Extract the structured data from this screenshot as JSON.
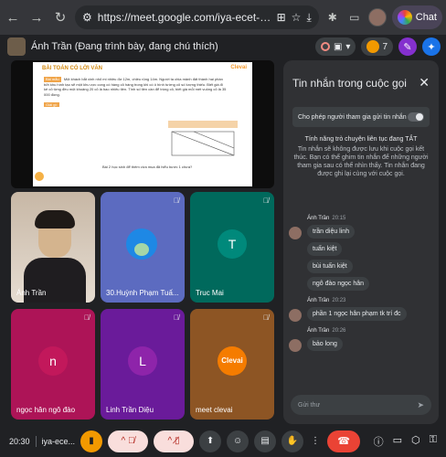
{
  "browser": {
    "url": "https://meet.google.com/iya-ecet-gjs?pli=1&au...",
    "chat_label": "Chat"
  },
  "meet_header": {
    "presenter_text": "Ánh Trần (Đang trình bày, đang chú thích)",
    "participant_count": "7"
  },
  "slide": {
    "title": "BÀI TOÁN CÓ LỜI VĂN",
    "logo": "Clevai",
    "tag1": "Bài mẫu",
    "body1": "Một khách bắt xinh nhỏ mi nhiều đơ 12m, chiều rộng 14m. Người ta chia mảnh đất thành hai phần bởi khu hình tạo sẽ một khu vực cong có hàng cỏ hàng trong khi có ô hình tường cỏ số lượng thiếu. Biết giá đi kẻ cỏ từng đều một khoảng 20 cỏ lá bao nhiêu tiền. Tính số tiền cần để trồng cỏ, biết giá mỗi mét vuông cỏ là 35 000 đồng.",
    "tag2": "Giải gì:",
    "question": "Bài 2 học sinh để thêm vừa mua đã hiểu bước 1 chưa?"
  },
  "chat_panel": {
    "title": "Tin nhắn trong cuộc gọi",
    "allow_label": "Cho phép người tham gia gửi tin nhắn",
    "notice_head": "Tính năng trò chuyện liên tục đang TẮT",
    "notice_body": "Tin nhắn sẽ không được lưu khi cuộc gọi kết thúc. Bạn có thể ghim tin nhắn để những người tham gia sau có thể nhìn thấy. Tin nhắn đang được ghi lại cùng với cuộc gọi.",
    "groups": [
      {
        "sender": "Ánh Trần",
        "time": "20:15",
        "messages": [
          "trần diệu linh",
          "tuấn kiệt",
          "bùi tuấn kiệt",
          "ngô đào ngọc hân"
        ]
      },
      {
        "sender": "Ánh Trần",
        "time": "20:23",
        "messages": [
          "phần 1 ngọc hân phạm tk trí đc"
        ]
      },
      {
        "sender": "Ánh Trần",
        "time": "20:26",
        "messages": [
          "bảo long"
        ]
      }
    ],
    "input_placeholder": "Gửi thư"
  },
  "tiles": [
    {
      "name": "Ánh Trần",
      "color": "#3c4043",
      "letter": ""
    },
    {
      "name": "30.Huỳnh Phạm Tuấ...",
      "color": "#5c6bc0",
      "letter": ""
    },
    {
      "name": "Truc Mai",
      "color": "#00695c",
      "letter": "T"
    },
    {
      "name": "ngọc hân ngô đào",
      "color": "#ad1457",
      "letter": "n"
    },
    {
      "name": "Linh Trần Diệu",
      "color": "#6a1b9a",
      "letter": "L"
    },
    {
      "name": "meet clevai",
      "color": "#8d5524",
      "letter": "Clevai"
    }
  ],
  "controls": {
    "clock": "20:30",
    "meet_code": "iya-ece..."
  }
}
